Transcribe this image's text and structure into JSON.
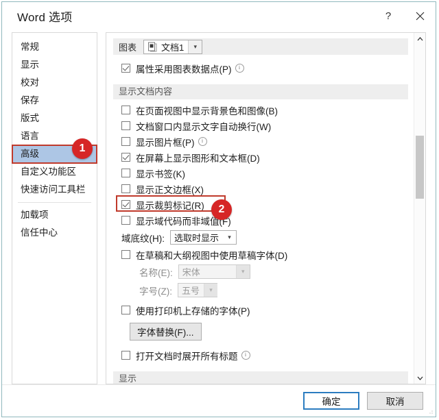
{
  "window": {
    "title": "Word 选项",
    "help_icon": "question-mark-icon",
    "close_icon": "close-icon"
  },
  "sidebar": {
    "items": [
      {
        "label": "常规",
        "selected": false
      },
      {
        "label": "显示",
        "selected": false
      },
      {
        "label": "校对",
        "selected": false
      },
      {
        "label": "保存",
        "selected": false
      },
      {
        "label": "版式",
        "selected": false
      },
      {
        "label": "语言",
        "selected": false
      },
      {
        "label": "高级",
        "selected": true
      },
      {
        "label": "自定义功能区",
        "selected": false
      },
      {
        "label": "快速访问工具栏",
        "selected": false
      },
      {
        "label": "加载项",
        "selected": false
      },
      {
        "label": "信任中心",
        "selected": false
      }
    ]
  },
  "annotations": {
    "badge_one": "1",
    "badge_two": "2",
    "highlight_color": "#c0392b",
    "badge_color": "#d62626"
  },
  "main": {
    "chart_section": {
      "label": "图表",
      "document_combo": {
        "value": "文档1",
        "icon": "document-icon",
        "arrow_icon": "chevron-down-icon"
      },
      "checkbox": {
        "label": "属性采用图表数据点(P)",
        "accel": "P",
        "checked": true,
        "info_icon": "info-icon"
      }
    },
    "display_section": {
      "header": "显示文档内容",
      "checkboxes": [
        {
          "label": "在页面视图中显示背景色和图像(B)",
          "accel": "B",
          "checked": false,
          "info": false
        },
        {
          "label": "文档窗口内显示文字自动换行(W)",
          "accel": "W",
          "checked": false,
          "info": false
        },
        {
          "label": "显示图片框(P)",
          "accel": "P",
          "checked": false,
          "info": true
        },
        {
          "label": "在屏幕上显示图形和文本框(D)",
          "accel": "D",
          "checked": true,
          "info": false
        },
        {
          "label": "显示书签(K)",
          "accel": "K",
          "checked": false,
          "info": false
        },
        {
          "label": "显示正文边框(X)",
          "accel": "X",
          "checked": false,
          "info": false
        },
        {
          "label": "显示裁剪标记(R)",
          "accel": "R",
          "checked": true,
          "info": false,
          "highlighted": true
        },
        {
          "label": "显示域代码而非域值(F)",
          "accel": "F",
          "checked": false,
          "info": false
        }
      ],
      "field_shading": {
        "label": "域底纹(H):",
        "accel": "H",
        "value": "选取时显示",
        "arrow_icon": "chevron-down-icon"
      },
      "draft_font_checkbox": {
        "label": "在草稿和大纲视图中使用草稿字体(D)",
        "accel": "D",
        "checked": false
      },
      "font_name": {
        "label": "名称(E):",
        "accel": "E",
        "value": "宋体",
        "disabled": true,
        "arrow_icon": "chevron-down-icon"
      },
      "font_size": {
        "label": "字号(Z):",
        "accel": "Z",
        "value": "五号",
        "disabled": true,
        "arrow_icon": "chevron-down-icon"
      },
      "printer_font_checkbox": {
        "label": "使用打印机上存储的字体(P)",
        "accel": "P",
        "checked": false
      },
      "font_substitution_button": "字体替换(F)...",
      "expand_headings_checkbox": {
        "label": "打开文档时展开所有标题",
        "checked": false,
        "info": true
      }
    },
    "next_section_header": "显示",
    "scrollbar": {
      "up_icon": "chevron-up-icon",
      "down_icon": "chevron-down-icon"
    }
  },
  "footer": {
    "ok_label": "确定",
    "cancel_label": "取消"
  }
}
